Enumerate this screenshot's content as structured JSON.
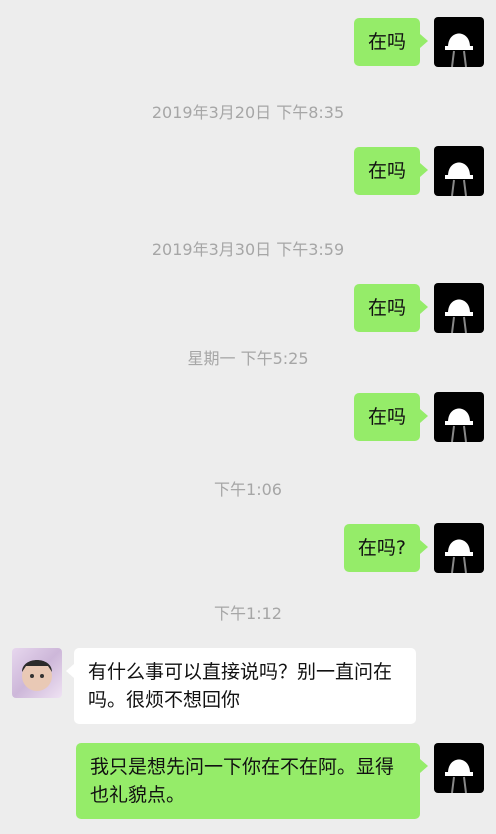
{
  "conversation": [
    {
      "kind": "message",
      "from": "me",
      "text": "在吗"
    },
    {
      "kind": "timestamp",
      "text": "2019年3月20日 下午8:35"
    },
    {
      "kind": "message",
      "from": "me",
      "text": "在吗"
    },
    {
      "kind": "timestamp",
      "text": "2019年3月30日 下午3:59"
    },
    {
      "kind": "message",
      "from": "me",
      "text": "在吗"
    },
    {
      "kind": "timestamp",
      "text": "星期一 下午5:25"
    },
    {
      "kind": "message",
      "from": "me",
      "text": "在吗"
    },
    {
      "kind": "timestamp",
      "text": "下午1:06"
    },
    {
      "kind": "message",
      "from": "me",
      "text": "在吗?"
    },
    {
      "kind": "timestamp",
      "text": "下午1:12"
    },
    {
      "kind": "message",
      "from": "friend",
      "text": "有什么事可以直接说吗？别一直问在吗。很烦不想回你"
    },
    {
      "kind": "message",
      "from": "me",
      "text": "我只是想先问一下你在不在阿。显得也礼貌点。"
    }
  ],
  "colors": {
    "background": "#ededed",
    "outgoing_bubble": "#95ec69",
    "incoming_bubble": "#ffffff",
    "timestamp_text": "#a6a6a6"
  },
  "icons": {
    "my_avatar": "white-helmet-on-black-avatar-icon",
    "friend_avatar": "child-photo-avatar-icon"
  }
}
